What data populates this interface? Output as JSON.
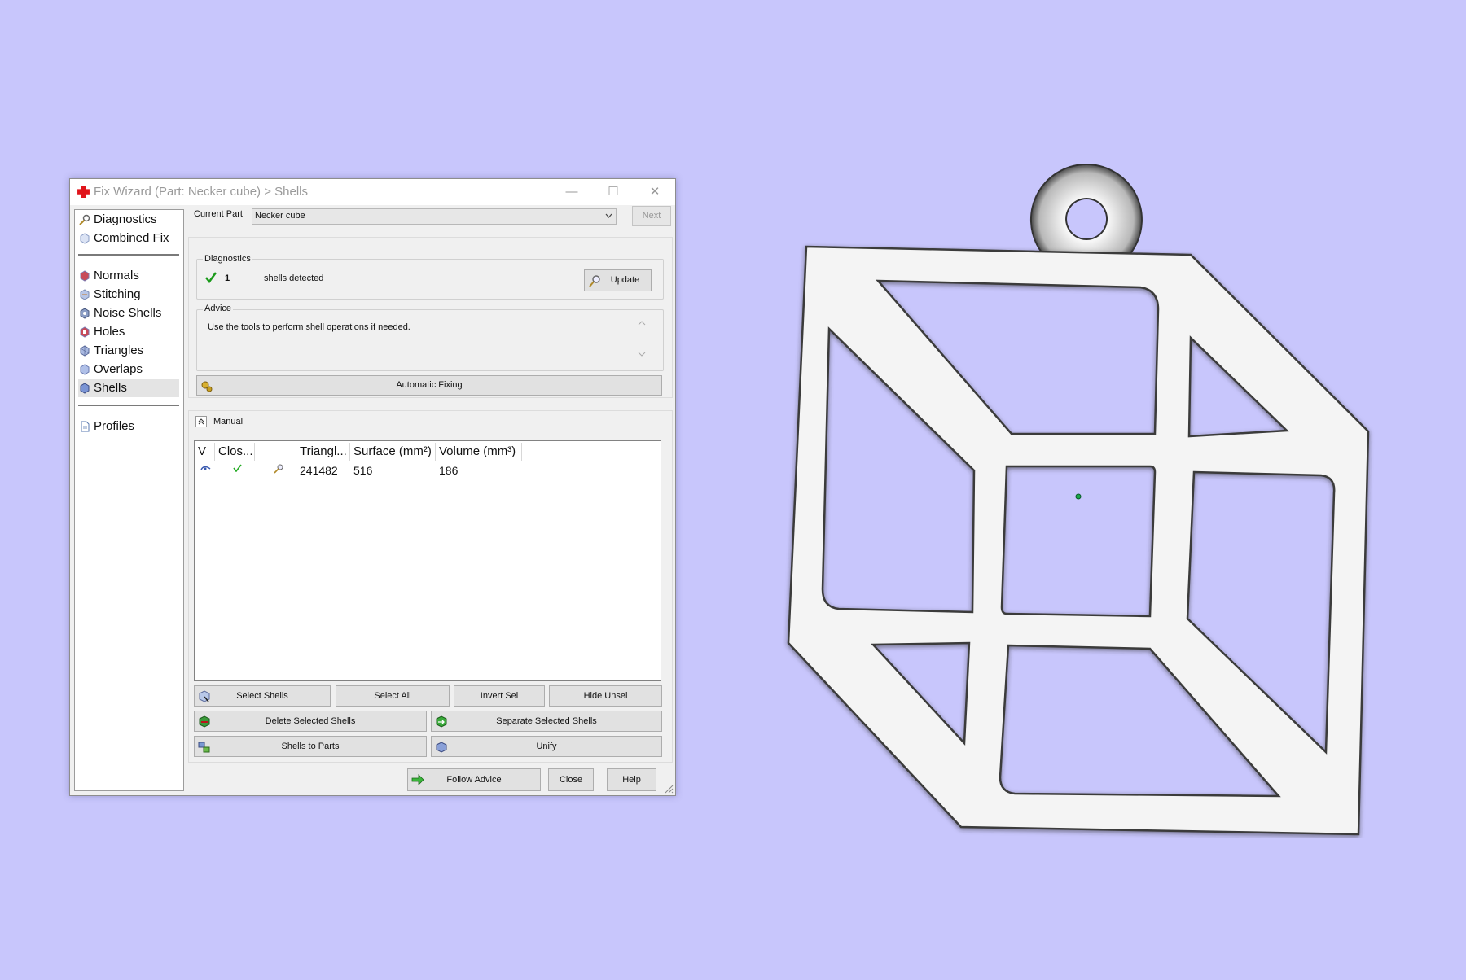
{
  "window": {
    "title": "Fix Wizard (Part: Necker cube) > Shells",
    "minimize": "—",
    "maximize": "☐",
    "close": "✕"
  },
  "sidebar": {
    "items": [
      {
        "label": "Diagnostics",
        "icon": "magnifier-icon"
      },
      {
        "label": "Combined Fix",
        "icon": "cube-icon"
      },
      {
        "label": "Normals",
        "icon": "normals-icon"
      },
      {
        "label": "Stitching",
        "icon": "stitching-icon"
      },
      {
        "label": "Noise Shells",
        "icon": "noise-shells-icon"
      },
      {
        "label": "Holes",
        "icon": "holes-icon"
      },
      {
        "label": "Triangles",
        "icon": "triangles-icon"
      },
      {
        "label": "Overlaps",
        "icon": "overlaps-icon"
      },
      {
        "label": "Shells",
        "icon": "shells-icon"
      },
      {
        "label": "Profiles",
        "icon": "document-icon"
      }
    ],
    "selected": "Shells"
  },
  "header": {
    "current_part_label": "Current Part",
    "current_part_value": "Necker cube",
    "next_label": "Next"
  },
  "diagnostics": {
    "title": "Diagnostics",
    "count": "1",
    "text": "shells detected",
    "update_label": "Update",
    "status_color": "#1a9a1a"
  },
  "advice": {
    "title": "Advice",
    "text": "Use the tools to perform shell operations if needed."
  },
  "automatic_fixing_label": "Automatic Fixing",
  "manual": {
    "title": "Manual",
    "columns": [
      "V",
      "Clos...",
      "",
      "Triangl...",
      "Surface (mm²)",
      "Volume (mm³)"
    ],
    "rows": [
      {
        "triangles": "241482",
        "surface": "516",
        "volume": "186"
      }
    ]
  },
  "buttons": {
    "select_shells": "Select Shells",
    "select_all": "Select All",
    "invert_sel": "Invert Sel",
    "hide_unsel": "Hide Unsel",
    "delete_selected": "Delete Selected Shells",
    "separate_selected": "Separate Selected Shells",
    "shells_to_parts": "Shells to Parts",
    "unify": "Unify",
    "follow_advice": "Follow Advice",
    "close": "Close",
    "help": "Help"
  },
  "colors": {
    "background": "#c8c6fc",
    "model_surface": "#f4f4f4",
    "accent_green": "#22aa22",
    "brand_red": "#e0141b"
  }
}
